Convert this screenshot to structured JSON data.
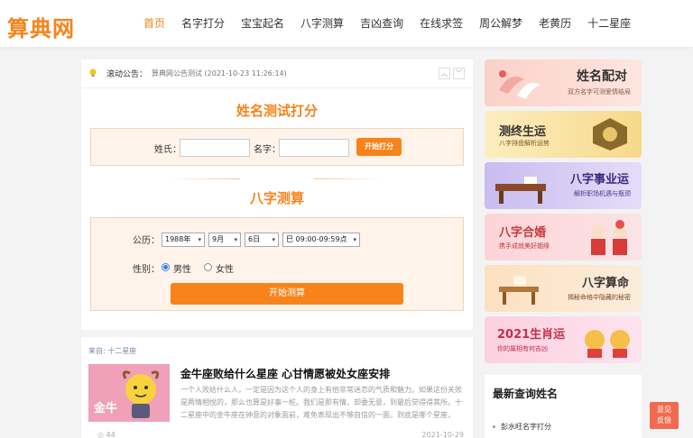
{
  "logo": "算典网",
  "nav": [
    "首页",
    "名字打分",
    "宝宝起名",
    "八字测算",
    "吉凶查询",
    "在线求签",
    "周公解梦",
    "老黄历",
    "十二星座"
  ],
  "notice": {
    "label": "滚动公告：",
    "text": "算典网公告测试 (2021-10-23 11:26:14)",
    "up": "︿",
    "down": "﹀"
  },
  "name_test": {
    "title": "姓名测试打分",
    "surname_label": "姓氏：",
    "name_label": "名字：",
    "surname_value": "",
    "name_value": "",
    "button": "开始打分"
  },
  "bazi": {
    "title": "八字测算",
    "calendar_label": "公历：",
    "year": "1988年",
    "month": "9月",
    "day": "6日",
    "hour": "巳 09:00-09:59点",
    "gender_label": "性别：",
    "male": "男性",
    "female": "女性",
    "button": "开始测算"
  },
  "article": {
    "source": "来自: 十二星座",
    "title": "金牛座败给什么星座 心甘情愿被处女座安排",
    "thumb_text": "金牛",
    "summary": "一个人败给什么人，一定是因为这个人的身上有他非常迷恋的气质和魅力。如果这份关败是两情相悦的，那么也算是好事一桩。我们是那有情，却委无意，到最后觉得得其所。十二星座中的金牛座在钟意的对象面前，难免表现出不够自信的一面。到底是哪个星座，",
    "views": "44",
    "date": "2021-10-29"
  },
  "banners": [
    {
      "title": "姓名配对",
      "sub": "双方名字可测爱情结局",
      "bg": "#fde3dc"
    },
    {
      "title": "测终生运",
      "sub": "八字排盘解析运势",
      "bg": "#fbe9b8"
    },
    {
      "title": "八字事业运",
      "sub": "解析职场机遇与瓶颈",
      "bg": "#d9d0f3"
    },
    {
      "title": "八字合婚",
      "sub": "携手成就美好姻缘",
      "bg": "#fbd7dc"
    },
    {
      "title": "八字算命",
      "sub": "揭秘命格中隐藏的秘密",
      "bg": "#fde6c8"
    },
    {
      "title": "2021生肖运",
      "sub": "你的属相有何吉凶",
      "bg": "#fdd9e6"
    }
  ],
  "sidebar": {
    "title": "最新查询姓名",
    "item": "彭水旺名字打分"
  },
  "feedback": {
    "line1": "意见",
    "line2": "反馈"
  },
  "colors": {
    "accent": "#f7831a",
    "feedback": "#f26a4f"
  }
}
